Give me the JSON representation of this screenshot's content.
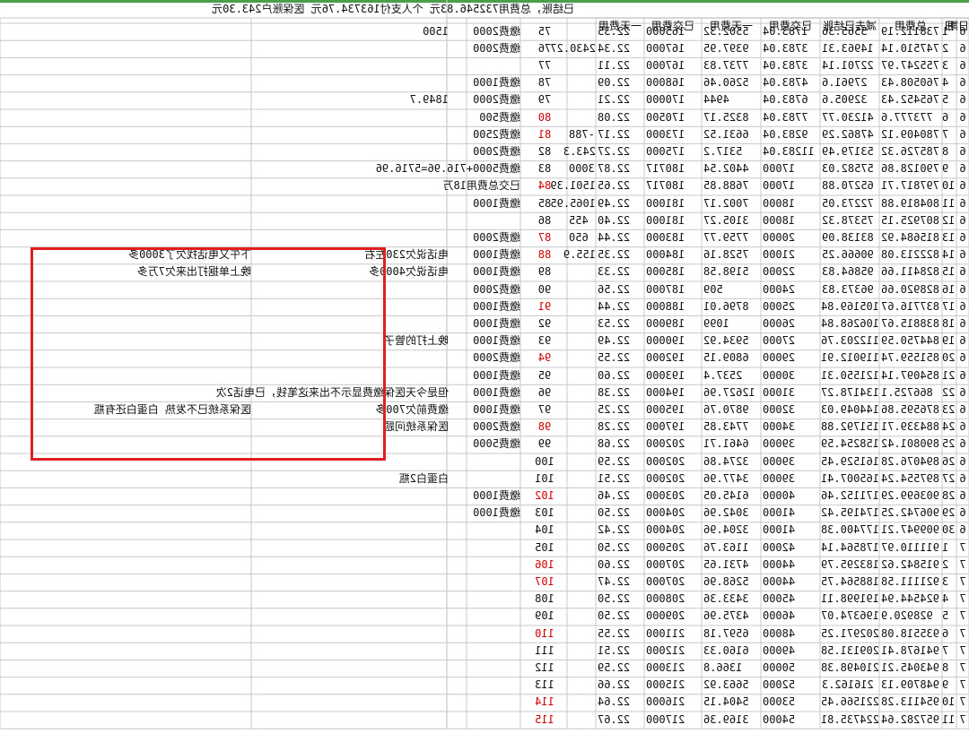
{
  "headline": "已结账，总费用732546.83元   个人支付163734.76元   医保账户243.30元",
  "header": [
    "日期",
    "日",
    "总费用",
    "减去已结账",
    "已交费用",
    "一天费用",
    "已交费用",
    "一天费用"
  ],
  "rows": [
    [
      "6",
      "1",
      "738112.19",
      "5565.36",
      "1783.04",
      "5502.32",
      "165000",
      "22.35",
      "",
      "75",
      "缴费2000",
      "1500",
      ""
    ],
    [
      "6",
      "2",
      "747510.14",
      "14963.31",
      "3783.04",
      "9397.95",
      "167000",
      "22.34",
      "2430.27",
      "76",
      "缴费2000",
      "",
      ""
    ],
    [
      "6",
      "3",
      "755247.97",
      "22701.14",
      "3783.04",
      "7737.83",
      "167000",
      "22.11",
      "",
      "77",
      "",
      "",
      ""
    ],
    [
      "6",
      "4",
      "760508.43",
      "27961.6",
      "4783.04",
      "5260.46",
      "168000",
      "22.09",
      "",
      "78",
      "缴费1000",
      "",
      ""
    ],
    [
      "6",
      "5",
      "765452.43",
      "32905.6",
      "6783.04",
      "4944",
      "170000",
      "22.21",
      "",
      "79",
      "缴费2000",
      "1849.7",
      ""
    ],
    [
      "6",
      "6",
      "773777.6",
      "41230.77",
      "7783.04",
      "8325.17",
      "170500",
      "22.08",
      "",
      "80",
      "缴费500",
      "",
      ""
    ],
    [
      "6",
      "7",
      "780409.12",
      "47862.29",
      "9283.04",
      "6631.52",
      "173000",
      "22.17",
      "-788",
      "81",
      "缴费2500",
      "",
      ""
    ],
    [
      "6",
      "8",
      "785726.32",
      "53179.49",
      "11283.04",
      "5317.2",
      "175000",
      "22.27",
      "243.3",
      "82",
      "缴费2000",
      "",
      ""
    ],
    [
      "6",
      "9",
      "790128.86",
      "57582.03",
      "17000",
      "4402.54",
      "180717",
      "22.87",
      "3000",
      "83",
      "缴费5000+716.96=5716.96",
      "",
      ""
    ],
    [
      "6",
      "10",
      "797817.71",
      "65270.88",
      "17000",
      "7688.85",
      "180717",
      "22.65",
      "1501.39",
      "84",
      "已交总费用18万",
      "",
      ""
    ],
    [
      "6",
      "11",
      "804819.88",
      "72273.05",
      "18000",
      "7002.17",
      "181000",
      "22.49",
      "1065.95",
      "85",
      "缴费1000",
      "",
      ""
    ],
    [
      "6",
      "12",
      "807925.15",
      "75378.32",
      "18000",
      "3105.27",
      "181000",
      "22.40",
      "455",
      "86",
      "",
      "",
      ""
    ],
    [
      "6",
      "13",
      "815684.92",
      "83138.09",
      "20000",
      "7759.77",
      "183000",
      "22.44",
      "650",
      "87",
      "缴费2000",
      "",
      ""
    ],
    [
      "6",
      "14",
      "822213.08",
      "90666.25",
      "21000",
      "7528.16",
      "184000",
      "22.35",
      "155.9",
      "88",
      "缴费1000",
      "电话说欠230左右",
      "下午又电话找欠了3000多"
    ],
    [
      "6",
      "15",
      "828411.66",
      "95864.83",
      "22000",
      "5198.58",
      "185000",
      "22.33",
      "",
      "89",
      "缴费1000",
      "电话说欠4000多",
      "晚上单据打出来欠7万多"
    ],
    [
      "6",
      "16",
      "828920.66",
      "96373.83",
      "24000",
      "509",
      "187000",
      "22.56",
      "",
      "90",
      "缴费2000",
      "",
      ""
    ],
    [
      "6",
      "17",
      "837716.67",
      "105169.84",
      "25000",
      "8796.01",
      "188000",
      "22.44",
      "",
      "91",
      "缴费1000",
      "",
      ""
    ],
    [
      "6",
      "18",
      "838815.67",
      "106268.84",
      "26000",
      "1099",
      "189000",
      "22.53",
      "",
      "92",
      "缴费1000",
      "",
      ""
    ],
    [
      "6",
      "19",
      "844750.59",
      "112203.76",
      "27000",
      "5934.92",
      "190000",
      "22.49",
      "",
      "93",
      "缴费1000",
      "晚上打的管子",
      ""
    ],
    [
      "6",
      "20",
      "851559.74",
      "119012.91",
      "29000",
      "6809.15",
      "192000",
      "22.55",
      "",
      "94",
      "缴费2000",
      "",
      ""
    ],
    [
      "6",
      "21",
      "854097.14",
      "121550.31",
      "30000",
      "2537.4",
      "193000",
      "22.60",
      "",
      "95",
      "缴费1000",
      "",
      ""
    ],
    [
      "6",
      "22",
      "866725.1",
      "134178.27",
      "31000",
      "12627.96",
      "194000",
      "22.38",
      "",
      "96",
      "缴费1000",
      "但是今天医保缴费显示不出来这笔钱，已电话2次",
      ""
    ],
    [
      "6",
      "23",
      "876595.86",
      "144049.03",
      "32000",
      "9870.76",
      "195000",
      "22.25",
      "",
      "97",
      "缴费1000",
      "缴费前欠700多",
      "医保系统已不发热     白蛋白还有瓶"
    ],
    [
      "6",
      "24",
      "884339.71",
      "151792.88",
      "34000",
      "7743.85",
      "197000",
      "22.28",
      "",
      "98",
      "缴费2000",
      "医保系统问题",
      ""
    ],
    [
      "6",
      "25",
      "890801.42",
      "158254.59",
      "39000",
      "6461.71",
      "202000",
      "22.68",
      "",
      "99",
      "缴费5000",
      "",
      ""
    ],
    [
      "6",
      "26",
      "894076.28",
      "161529.45",
      "39000",
      "3274.86",
      "202000",
      "22.59",
      "",
      "100",
      "",
      "",
      ""
    ],
    [
      "6",
      "27",
      "897554.24",
      "165007.41",
      "39000",
      "3477.96",
      "202000",
      "22.51",
      "",
      "101",
      "",
      "白蛋白2瓶",
      ""
    ],
    [
      "6",
      "28",
      "903699.29",
      "171152.46",
      "40000",
      "6145.05",
      "203000",
      "22.46",
      "",
      "102",
      "缴费1000",
      "",
      ""
    ],
    [
      "6",
      "29",
      "906742.25",
      "174195.42",
      "41000",
      "3042.96",
      "204000",
      "22.50",
      "",
      "103",
      "缴费1000",
      "",
      ""
    ],
    [
      "6",
      "30",
      "909947.21",
      "177400.38",
      "41000",
      "3204.96",
      "204000",
      "22.42",
      "",
      "104",
      "",
      "",
      ""
    ],
    [
      "7",
      "1",
      "911110.97",
      "178564.14",
      "42000",
      "1163.76",
      "205000",
      "22.50",
      "",
      "105",
      "",
      "",
      ""
    ],
    [
      "7",
      "2",
      "915842.62",
      "183295.79",
      "44000",
      "4731.65",
      "207000",
      "22.60",
      "",
      "106",
      "",
      "",
      ""
    ],
    [
      "7",
      "3",
      "921111.58",
      "188564.75",
      "44000",
      "5268.96",
      "207000",
      "22.47",
      "",
      "107",
      "",
      "",
      ""
    ],
    [
      "7",
      "4",
      "924544.94",
      "191998.11",
      "45000",
      "3433.36",
      "208000",
      "22.50",
      "",
      "108",
      "",
      "",
      ""
    ],
    [
      "7",
      "5",
      "928920.9",
      "196374.07",
      "46000",
      "4375.96",
      "209000",
      "22.50",
      "",
      "109",
      "",
      "",
      ""
    ],
    [
      "7",
      "6",
      "935518.08",
      "202971.25",
      "48000",
      "6597.18",
      "211000",
      "22.55",
      "",
      "110",
      "",
      "",
      ""
    ],
    [
      "7",
      "7",
      "941678.41",
      "209131.58",
      "49000",
      "6160.33",
      "212000",
      "22.51",
      "",
      "111",
      "",
      "",
      ""
    ],
    [
      "7",
      "8",
      "943045.21",
      "210498.38",
      "50000",
      "1366.8",
      "213000",
      "22.59",
      "",
      "112",
      "",
      "",
      ""
    ],
    [
      "7",
      "9",
      "948709.13",
      "216162.3",
      "52000",
      "5663.92",
      "215000",
      "22.66",
      "",
      "113",
      "",
      "",
      ""
    ],
    [
      "7",
      "10",
      "954113.28",
      "221566.45",
      "53000",
      "5404.15",
      "216000",
      "22.64",
      "",
      "114",
      "",
      "",
      ""
    ],
    [
      "7",
      "11",
      "957282.64",
      "224735.81",
      "54000",
      "3169.36",
      "217000",
      "22.67",
      "",
      "115",
      "",
      "",
      ""
    ]
  ],
  "red_days": [
    "80",
    "81",
    "84",
    "87",
    "88",
    "91",
    "94",
    "98",
    "102",
    "106",
    "107",
    "110",
    "114",
    "115"
  ],
  "colors": {
    "grid": "#c8c8c8",
    "text": "#111111",
    "red": "#d00000",
    "box": "#e02020",
    "green": "#4aa04a"
  }
}
